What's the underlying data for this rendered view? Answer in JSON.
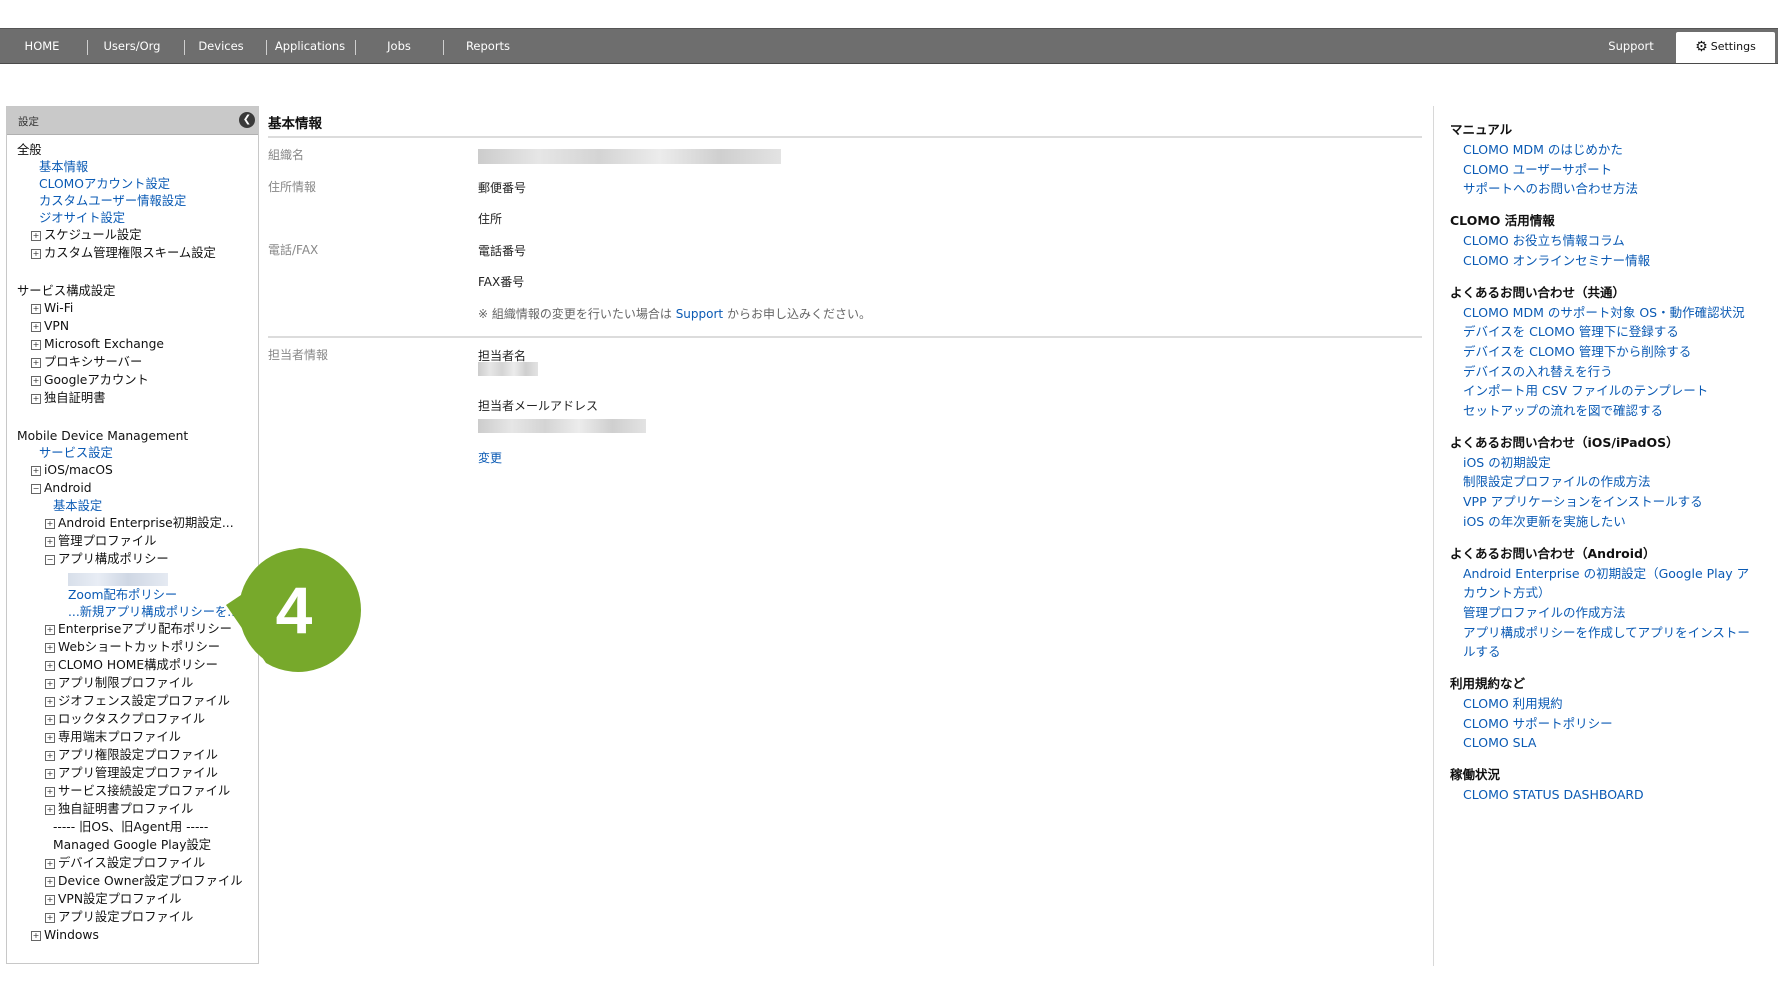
{
  "nav": {
    "home": "HOME",
    "users": "Users/Org",
    "devices": "Devices",
    "applications": "Applications",
    "jobs": "Jobs",
    "reports": "Reports",
    "support": "Support",
    "settings": "Settings"
  },
  "sidebar": {
    "title": "設定",
    "lines": [
      {
        "text": "全般",
        "type": "header",
        "indent": 0
      },
      {
        "text": "基本情報",
        "type": "link",
        "indent": 1
      },
      {
        "text": "CLOMOアカウント設定",
        "type": "link",
        "indent": 1
      },
      {
        "text": "カスタムユーザー情報設定",
        "type": "link",
        "indent": 1
      },
      {
        "text": "ジオサイト設定",
        "type": "link",
        "indent": 1
      },
      {
        "text": "スケジュール設定",
        "type": "plus",
        "indent": 1
      },
      {
        "text": "カスタム管理権限スキーム設定",
        "type": "plus",
        "indent": 1
      },
      {
        "text": "サービス構成設定",
        "type": "header",
        "indent": 0
      },
      {
        "text": "Wi-Fi",
        "type": "plus",
        "indent": 1
      },
      {
        "text": "VPN",
        "type": "plus",
        "indent": 1
      },
      {
        "text": "Microsoft Exchange",
        "type": "plus",
        "indent": 1
      },
      {
        "text": "プロキシサーバー",
        "type": "plus",
        "indent": 1
      },
      {
        "text": "Googleアカウント",
        "type": "plus",
        "indent": 1
      },
      {
        "text": "独自証明書",
        "type": "plus",
        "indent": 1
      },
      {
        "text": "Mobile Device Management",
        "type": "header",
        "indent": 0
      },
      {
        "text": "サービス設定",
        "type": "link",
        "indent": 1
      },
      {
        "text": "iOS/macOS",
        "type": "plus",
        "indent": 1
      },
      {
        "text": "Android",
        "type": "minus",
        "indent": 1
      },
      {
        "text": "基本設定",
        "type": "link",
        "indent": 2
      },
      {
        "text": "Android Enterprise初期設定...",
        "type": "plus",
        "indent": 2
      },
      {
        "text": "管理プロファイル",
        "type": "plus",
        "indent": 2
      },
      {
        "text": "アプリ構成ポリシー",
        "type": "minus",
        "indent": 2
      },
      {
        "text": "",
        "type": "blurred",
        "indent": 3
      },
      {
        "text": "Zoom配布ポリシー",
        "type": "link",
        "indent": 3
      },
      {
        "text": "...新規アプリ構成ポリシーを...",
        "type": "link",
        "indent": 3
      },
      {
        "text": "Enterpriseアプリ配布ポリシー",
        "type": "plus",
        "indent": 2
      },
      {
        "text": "Webショートカットポリシー",
        "type": "plus",
        "indent": 2
      },
      {
        "text": "CLOMO HOME構成ポリシー",
        "type": "plus",
        "indent": 2
      },
      {
        "text": "アプリ制限プロファイル",
        "type": "plus",
        "indent": 2
      },
      {
        "text": "ジオフェンス設定プロファイル",
        "type": "plus",
        "indent": 2
      },
      {
        "text": "ロックタスクプロファイル",
        "type": "plus",
        "indent": 2
      },
      {
        "text": "専用端末プロファイル",
        "type": "plus",
        "indent": 2
      },
      {
        "text": "アプリ権限設定プロファイル",
        "type": "plus",
        "indent": 2
      },
      {
        "text": "アプリ管理設定プロファイル",
        "type": "plus",
        "indent": 2
      },
      {
        "text": "サービス接続設定プロファイル",
        "type": "plus",
        "indent": 2
      },
      {
        "text": "独自証明書プロファイル",
        "type": "plus",
        "indent": 2
      },
      {
        "text": "----- 旧OS、旧Agent用 -----",
        "type": "text",
        "indent": 2
      },
      {
        "text": "Managed Google Play設定",
        "type": "text",
        "indent": 2
      },
      {
        "text": "デバイス設定プロファイル",
        "type": "plus",
        "indent": 2
      },
      {
        "text": "Device Owner設定プロファイル",
        "type": "plus",
        "indent": 2
      },
      {
        "text": "VPN設定プロファイル",
        "type": "plus",
        "indent": 2
      },
      {
        "text": "アプリ設定プロファイル",
        "type": "plus",
        "indent": 2
      },
      {
        "text": "Windows",
        "type": "plus",
        "indent": 1
      }
    ]
  },
  "main": {
    "title": "基本情報",
    "org_label": "組織名",
    "address_label": "住所情報",
    "postal_label": "郵便番号",
    "address_field": "住所",
    "phone_label": "電話/FAX",
    "phone_field": "電話番号",
    "fax_field": "FAX番号",
    "note_prefix": "※ 組織情報の変更を行いたい場合は ",
    "note_link": "Support",
    "note_suffix": " からお申し込みください。",
    "contact_label": "担当者情報",
    "contact_name_label": "担当者名",
    "contact_email_label": "担当者メールアドレス",
    "change_link": "変更"
  },
  "callout": {
    "number": "4",
    "color": "#77a92b"
  },
  "help": {
    "sections": [
      {
        "title": "マニュアル",
        "links": [
          "CLOMO MDM のはじめかた",
          "CLOMO ユーザーサポート",
          "サポートへのお問い合わせ方法"
        ]
      },
      {
        "title": "CLOMO 活用情報",
        "links": [
          "CLOMO お役立ち情報コラム",
          "CLOMO オンラインセミナー情報"
        ]
      },
      {
        "title": "よくあるお問い合わせ（共通）",
        "links": [
          "CLOMO MDM のサポート対象 OS・動作確認状況",
          "デバイスを CLOMO 管理下に登録する",
          "デバイスを CLOMO 管理下から削除する",
          "デバイスの入れ替えを行う",
          "インポート用 CSV ファイルのテンプレート",
          "セットアップの流れを図で確認する"
        ]
      },
      {
        "title": "よくあるお問い合わせ（iOS/iPadOS）",
        "links": [
          "iOS の初期設定",
          "制限設定プロファイルの作成方法",
          "VPP アプリケーションをインストールする",
          "iOS の年次更新を実施したい"
        ]
      },
      {
        "title": "よくあるお問い合わせ（Android）",
        "links": [
          "Android Enterprise の初期設定（Google Play ア",
          "カウント方式）",
          "管理プロファイルの作成方法",
          "アプリ構成ポリシーを作成してアプリをインストー",
          "ルする"
        ]
      },
      {
        "title": "利用規約など",
        "links": [
          "CLOMO 利用規約",
          "CLOMO サポートポリシー",
          "CLOMO SLA"
        ]
      },
      {
        "title": "稼働状況",
        "links": [
          "CLOMO STATUS DASHBOARD"
        ]
      }
    ]
  }
}
